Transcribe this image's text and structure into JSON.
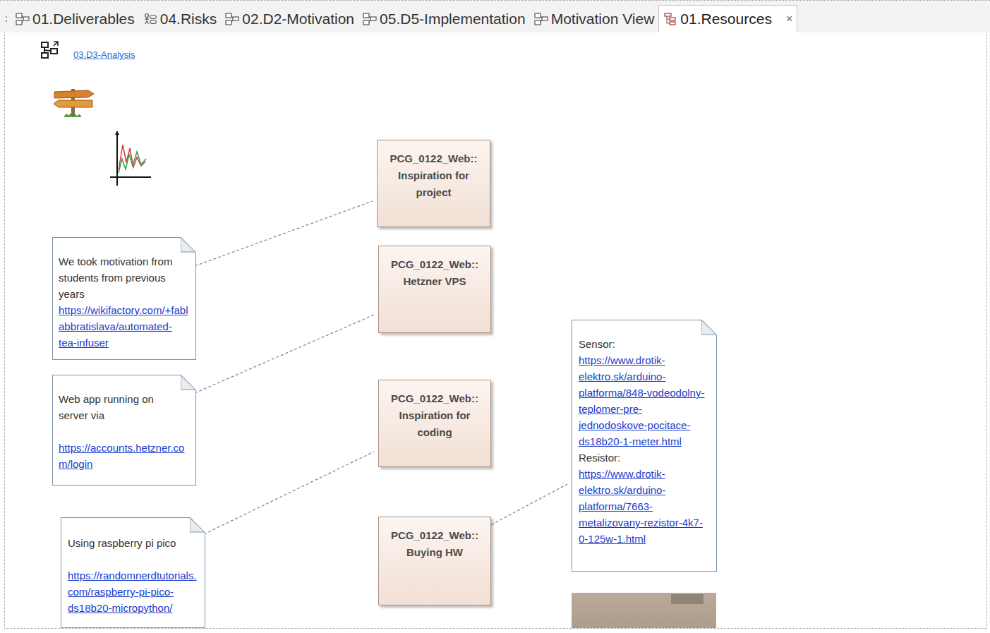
{
  "tabs": [
    {
      "label": "01.Deliverables",
      "selected": false,
      "kind": "diagram"
    },
    {
      "label": "04.Risks",
      "selected": false,
      "kind": "usecase"
    },
    {
      "label": "02.D2-Motivation",
      "selected": false,
      "kind": "diagram"
    },
    {
      "label": "05.D5-Implementation",
      "selected": false,
      "kind": "diagram"
    },
    {
      "label": "Motivation View",
      "selected": false,
      "kind": "diagram"
    },
    {
      "label": "01.Resources",
      "selected": true,
      "kind": "tree"
    }
  ],
  "close_label": "×",
  "diagram": {
    "hyperlink": {
      "label": "03.D3-Analysis"
    },
    "elements": [
      {
        "package": "PCG_0122_Web::",
        "name": "Inspiration for project"
      },
      {
        "package": "PCG_0122_Web::",
        "name": "Hetzner VPS"
      },
      {
        "package": "PCG_0122_Web::",
        "name": "Inspiration for coding"
      },
      {
        "package": "PCG_0122_Web::",
        "name": "Buying HW"
      }
    ],
    "notes": [
      {
        "segments": [
          {
            "kind": "text",
            "text": "We took motivation from students from previous years",
            "spaced": false
          },
          {
            "kind": "link",
            "text": "https://wikifactory.com/+fablabbratislava/automated-tea-infuser",
            "spaced": false
          }
        ]
      },
      {
        "segments": [
          {
            "kind": "text",
            "text": "Web app running on server via",
            "spaced": false
          },
          {
            "kind": "link",
            "text": "https://accounts.hetzner.com/login",
            "spaced": true
          }
        ]
      },
      {
        "segments": [
          {
            "kind": "text",
            "text": "Using raspberry pi pico",
            "spaced": false
          },
          {
            "kind": "link",
            "text": "https://randomnerdtutorials.com/raspberry-pi-pico-ds18b20-micropython/",
            "spaced": true
          }
        ]
      },
      {
        "segments": [
          {
            "kind": "text",
            "text": "Sensor:",
            "spaced": false
          },
          {
            "kind": "link",
            "text": "https://www.drotik-elektro.sk/arduino-platforma/848-vodeodolny-teplomer-pre-jednodoskove-pocitace-ds18b20-1-meter.html",
            "spaced": false
          },
          {
            "kind": "text",
            "text": "Resistor:",
            "spaced": false
          },
          {
            "kind": "link",
            "text": "https://www.drotik-elektro.sk/arduino-platforma/7663-metalizovany-rezistor-4k7-0-125w-1.html",
            "spaced": false
          }
        ]
      }
    ]
  }
}
